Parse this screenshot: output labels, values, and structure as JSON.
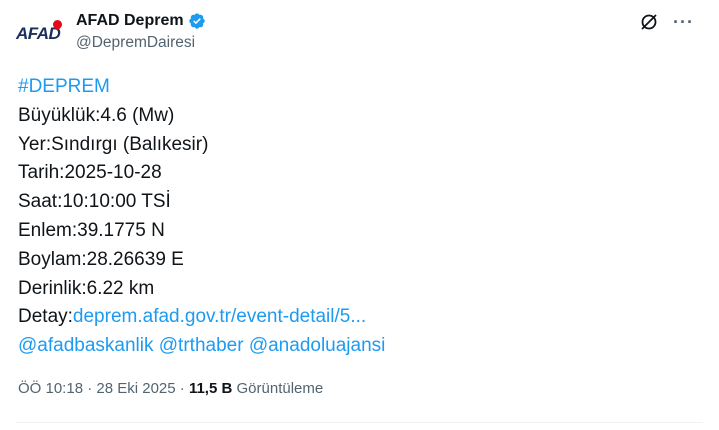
{
  "author": {
    "display_name": "AFAD Deprem",
    "handle": "@DepremDairesi",
    "logo_text": "AFAD",
    "verified": true,
    "verified_color": "#1d9bf0"
  },
  "header_icons": {
    "grok": "grok-icon",
    "more": "more-icon",
    "more_glyph": "···"
  },
  "tweet": {
    "hashtag": "#DEPREM",
    "magnitude": "Büyüklük:4.6 (Mw)",
    "location": "Yer:Sındırgı (Balıkesir)",
    "date": "Tarih:2025-10-28",
    "time": "Saat:10:10:00 TSİ",
    "latitude": "Enlem:39.1775 N",
    "longitude": "Boylam:28.26639 E",
    "depth": "Derinlik:6.22 km",
    "detail_label": "Detay:",
    "detail_link": "deprem.afad.gov.tr/event-detail/5...",
    "mentions": [
      "@afadbaskanlik",
      "@trthaber",
      "@anadoluajansi"
    ]
  },
  "meta": {
    "timestamp": "ÖÖ 10:18 · 28 Eki 2025",
    "separator": " · ",
    "views_count": "11,5 B",
    "views_label": "Görüntüleme"
  },
  "colors": {
    "link": "#1d9bf0",
    "text": "#0f1419",
    "secondary": "#536471",
    "afad_blue": "#1a2f5c",
    "afad_red": "#e30a17"
  }
}
